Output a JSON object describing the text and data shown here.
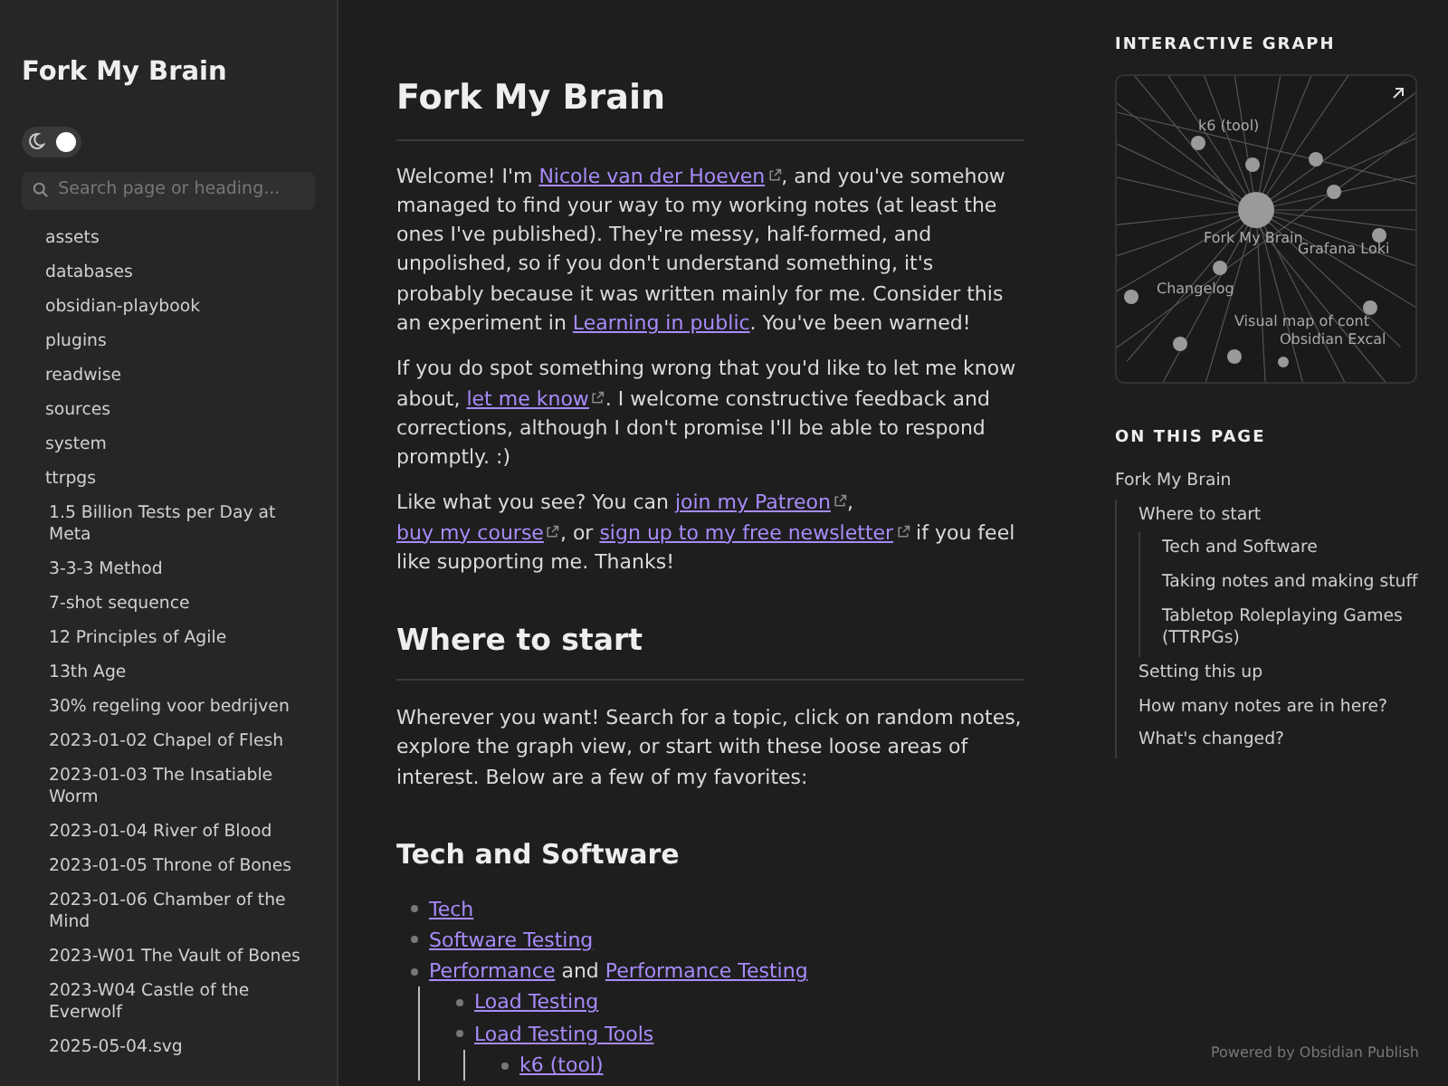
{
  "site_title": "Fork My Brain",
  "theme_toggle": {
    "dark": true
  },
  "search": {
    "placeholder": "Search page or heading..."
  },
  "sidebar": {
    "items": [
      {
        "label": "assets",
        "kind": "folder"
      },
      {
        "label": "databases",
        "kind": "folder"
      },
      {
        "label": "obsidian-playbook",
        "kind": "folder"
      },
      {
        "label": "plugins",
        "kind": "folder"
      },
      {
        "label": "readwise",
        "kind": "folder"
      },
      {
        "label": "sources",
        "kind": "folder"
      },
      {
        "label": "system",
        "kind": "folder"
      },
      {
        "label": "ttrpgs",
        "kind": "folder"
      },
      {
        "label": "1.5 Billion Tests per Day at Meta",
        "kind": "file"
      },
      {
        "label": "3-3-3 Method",
        "kind": "file"
      },
      {
        "label": "7-shot sequence",
        "kind": "file"
      },
      {
        "label": "12 Principles of Agile",
        "kind": "file"
      },
      {
        "label": "13th Age",
        "kind": "file"
      },
      {
        "label": "30% regeling voor bedrijven",
        "kind": "file"
      },
      {
        "label": "2023-01-02 Chapel of Flesh",
        "kind": "file"
      },
      {
        "label": "2023-01-03 The Insatiable Worm",
        "kind": "file"
      },
      {
        "label": "2023-01-04 River of Blood",
        "kind": "file"
      },
      {
        "label": "2023-01-05 Throne of Bones",
        "kind": "file"
      },
      {
        "label": "2023-01-06 Chamber of the Mind",
        "kind": "file"
      },
      {
        "label": "2023-W01 The Vault of Bones",
        "kind": "file"
      },
      {
        "label": "2023-W04 Castle of the Everwolf",
        "kind": "file"
      },
      {
        "label": "2025-05-04.svg",
        "kind": "file"
      }
    ]
  },
  "article": {
    "title": "Fork My Brain",
    "intro": [
      [
        {
          "kind": "text",
          "text": "Welcome! I'm "
        },
        {
          "kind": "link",
          "text": "Nicole van der Hoeven",
          "external": true
        },
        {
          "kind": "text",
          "text": ", and you've somehow managed to find your way to my working notes (at least the ones I've published). They're messy, half-formed, and unpolished, so if you don't understand something, it's probably because it was written mainly for me. Consider this an experiment in "
        },
        {
          "kind": "link",
          "text": "Learning in public",
          "external": false
        },
        {
          "kind": "text",
          "text": ". You've been warned!"
        }
      ],
      [
        {
          "kind": "text",
          "text": "If you do spot something wrong that you'd like to let me know about, "
        },
        {
          "kind": "link",
          "text": "let me know",
          "external": true
        },
        {
          "kind": "text",
          "text": ". I welcome constructive feedback and corrections, although I don't promise I'll be able to respond promptly. :)"
        }
      ],
      [
        {
          "kind": "text",
          "text": "Like what you see? You can "
        },
        {
          "kind": "link",
          "text": "join my Patreon",
          "external": true
        },
        {
          "kind": "text",
          "text": ", "
        },
        {
          "kind": "link",
          "text": "buy my course",
          "external": true
        },
        {
          "kind": "text",
          "text": ", or "
        },
        {
          "kind": "link",
          "text": "sign up to my free newsletter",
          "external": true
        },
        {
          "kind": "text",
          "text": " if you feel like supporting me. Thanks!"
        }
      ]
    ],
    "section_title": "Where to start",
    "section_text": "Wherever you want! Search for a topic, click on random notes, explore the graph view, or start with these loose areas of interest. Below are a few of my favorites:",
    "subsection_title": "Tech and Software",
    "list": [
      {
        "parts": [
          {
            "kind": "link",
            "text": "Tech"
          }
        ]
      },
      {
        "parts": [
          {
            "kind": "link",
            "text": "Software Testing"
          }
        ]
      },
      {
        "parts": [
          {
            "kind": "link",
            "text": "Performance"
          },
          {
            "kind": "text",
            "text": " and "
          },
          {
            "kind": "link",
            "text": "Performance Testing"
          }
        ],
        "children": [
          {
            "parts": [
              {
                "kind": "link",
                "text": "Load Testing"
              }
            ]
          },
          {
            "parts": [
              {
                "kind": "link",
                "text": "Load Testing Tools"
              }
            ],
            "children": [
              {
                "parts": [
                  {
                    "kind": "link",
                    "text": "k6 (tool)"
                  }
                ]
              }
            ]
          }
        ]
      }
    ]
  },
  "graph": {
    "title": "INTERACTIVE GRAPH",
    "nodes": [
      "k6 (tool)",
      "Fork My Brain",
      "Grafana Loki",
      "Changelog",
      "Visual map of cont",
      "Obsidian Excal"
    ]
  },
  "toc": {
    "title": "ON THIS PAGE",
    "items": [
      {
        "label": "Fork My Brain",
        "children": [
          {
            "label": "Where to start",
            "children": [
              {
                "label": "Tech and Software"
              },
              {
                "label": "Taking notes and making stuff"
              },
              {
                "label": "Tabletop Roleplaying Games (TTRPGs)"
              }
            ]
          },
          {
            "label": "Setting this up"
          },
          {
            "label": "How many notes are in here?"
          },
          {
            "label": "What's changed?"
          }
        ]
      }
    ]
  },
  "footer": "Powered by Obsidian Publish"
}
